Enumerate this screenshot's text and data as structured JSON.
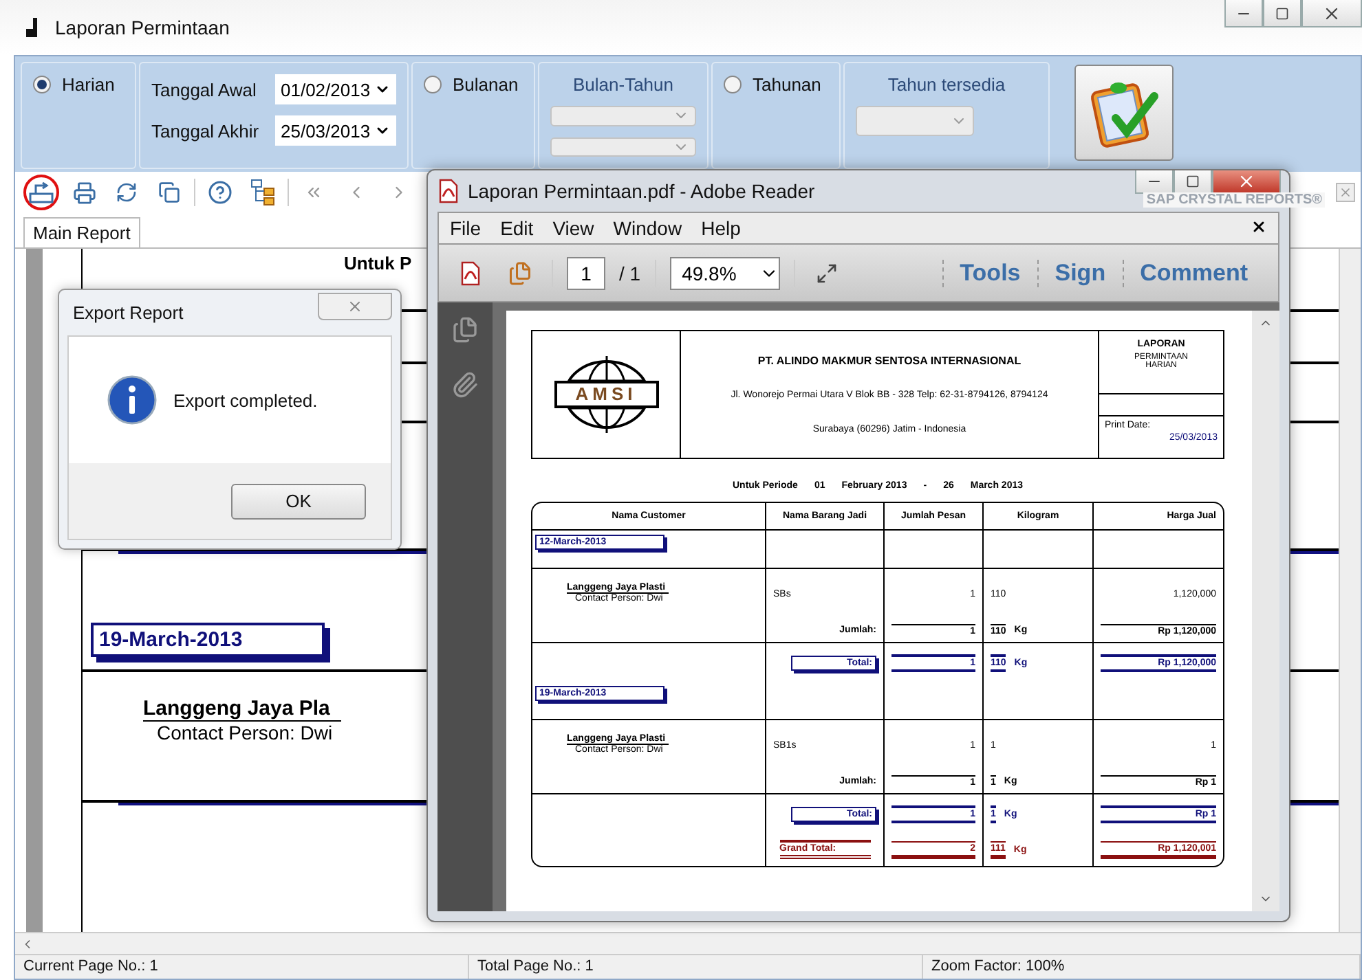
{
  "window": {
    "title": "Laporan Permintaan"
  },
  "filter": {
    "modes": [
      {
        "label": "Harian",
        "selected": true
      },
      {
        "label": "Bulanan",
        "selected": false
      },
      {
        "label": "Tahunan",
        "selected": false
      }
    ],
    "date_fields": [
      {
        "label": "Tanggal Awal",
        "value": "01/02/2013"
      },
      {
        "label": "Tanggal Akhir",
        "value": "25/03/2013"
      }
    ],
    "month_year": {
      "label": "Bulan-Tahun"
    },
    "year": {
      "label": "Tahun tersedia"
    }
  },
  "viewer": {
    "brand": "SAP CRYSTAL REPORTS®",
    "tabs": [
      {
        "label": "Main Report",
        "selected": true
      }
    ],
    "report": {
      "period_label": "Untuk P",
      "group_date": "19-March-2013",
      "customer": "Langgeng Jaya Pla",
      "contact": "Contact Person: Dwi"
    },
    "status_bar": [
      "Current Page No.: 1",
      "Total Page No.: 1",
      "Zoom Factor: 100%"
    ]
  },
  "export_dialog": {
    "title": "Export Report",
    "message": "Export completed.",
    "button": "OK"
  },
  "reader": {
    "title": "Laporan Permintaan.pdf - Adobe Reader",
    "menu": [
      "File",
      "Edit",
      "View",
      "Window",
      "Help"
    ],
    "page": "1",
    "page_total": "/ 1",
    "zoom": "49.8%",
    "panels": [
      "Tools",
      "Sign",
      "Comment"
    ],
    "document": {
      "logo_text": "AMSI",
      "company": "PT. ALINDO MAKMUR SENTOSA INTERNASIONAL",
      "address": "Jl. Wonorejo Permai Utara V Blok BB - 328 Telp: 62-31-8794126, 8794124",
      "city": "Surabaya (60296) Jatim - Indonesia",
      "report_title": "LAPORAN",
      "report_subtitle": "PERMINTAAN HARIAN",
      "print_date_label": "Print Date:",
      "print_date": "25/03/2013",
      "period": [
        "Untuk Periode",
        "01",
        "February 2013",
        "-",
        "26",
        "March 2013"
      ],
      "columns": [
        "Nama Customer",
        "Nama Barang Jadi",
        "Jumlah Pesan",
        "Kilogram",
        "Harga Jual"
      ],
      "groups": [
        {
          "date": "12-March-2013",
          "customer": "Langgeng Jaya Plasti",
          "contact_label": "Contact Person:",
          "contact": "Dwi",
          "item": "SBs",
          "qty": "1",
          "kg": "110",
          "price": "1,120,000",
          "sum_label": "Jumlah:",
          "sum_qty": "1",
          "sum_kg": "110",
          "sum_unit": "Kg",
          "sum_price": "Rp 1,120,000",
          "total_label": "Total:",
          "total_qty": "1",
          "total_kg": "110",
          "total_unit": "Kg",
          "total_price": "Rp 1,120,000"
        },
        {
          "date": "19-March-2013",
          "customer": "Langgeng Jaya Plasti",
          "contact_label": "Contact Person:",
          "contact": "Dwi",
          "item": "SB1s",
          "qty": "1",
          "kg": "1",
          "price": "1",
          "sum_label": "Jumlah:",
          "sum_qty": "1",
          "sum_kg": "1",
          "sum_unit": "Kg",
          "sum_price": "Rp 1",
          "total_label": "Total:",
          "total_qty": "1",
          "total_kg": "1",
          "total_unit": "Kg",
          "total_price": "Rp 1"
        }
      ],
      "grand_total": {
        "label": "Grand Total:",
        "qty": "2",
        "kg": "111",
        "unit": "Kg",
        "price": "Rp 1,120,001"
      }
    }
  }
}
